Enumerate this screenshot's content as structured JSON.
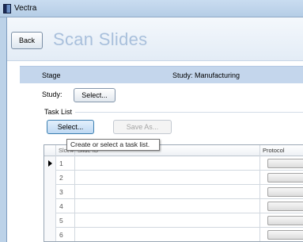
{
  "window": {
    "title": "Vectra",
    "icon": "vectra-app-icon"
  },
  "header": {
    "back_label": "Back",
    "page_title": "Scan Slides"
  },
  "stage_bar": {
    "stage_label": "Stage",
    "study_summary": "Study: Manufacturing"
  },
  "study": {
    "label": "Study:",
    "select_label": "Select..."
  },
  "task_list": {
    "section_label": "Task List",
    "select_label": "Select...",
    "save_as_label": "Save As...",
    "tooltip": "Create or select a task list."
  },
  "grid": {
    "columns": [
      "Slot #",
      "Slide ID",
      "Protocol"
    ],
    "rows": [
      {
        "slot": "1",
        "current": true
      },
      {
        "slot": "2",
        "current": false
      },
      {
        "slot": "3",
        "current": false
      },
      {
        "slot": "4",
        "current": false
      },
      {
        "slot": "5",
        "current": false
      },
      {
        "slot": "6",
        "current": false
      }
    ]
  }
}
